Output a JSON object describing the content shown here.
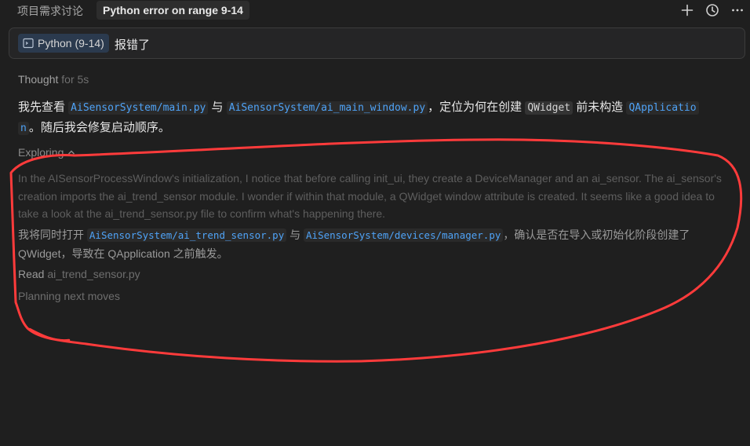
{
  "header": {
    "inactive_tab": "项目需求讨论",
    "active_tab": "Python error on range 9-14",
    "icons": [
      "plus-icon",
      "history-icon",
      "more-icon"
    ]
  },
  "input": {
    "chip_label": "Python (9-14)",
    "text": "报错了"
  },
  "thought": {
    "label": "Thought",
    "duration": "for 5s"
  },
  "response": {
    "t1": "我先查看 ",
    "c1": "AiSensorSystem/main.py",
    "t2": " 与 ",
    "c2": "AiSensorSystem/ai_main_window.py",
    "t3": "，定位为何在创建 ",
    "c3": "QWidget",
    "t4": " 前未构造 ",
    "c4a": "QApplicatio",
    "c4b": "n",
    "t5": "。随后我会修复启动顺序。"
  },
  "exploring": {
    "label": "Exploring"
  },
  "reasoning": {
    "text": "In the AISensorProcessWindow's initialization, I notice that before calling init_ui, they create a DeviceManager and an ai_sensor. The ai_sensor's creation imports the ai_trend_sensor module. I wonder if within that module, a QWidget window attribute is created. It seems like a good idea to take a look at the ai_trend_sensor.py file to confirm what's happening there."
  },
  "plan": {
    "t1": "我将同时打开 ",
    "c1": "AiSensorSystem/ai_trend_sensor.py",
    "t2": " 与 ",
    "c2": "AiSensorSystem/devices/manager.py",
    "t3": "，确认是否在导入或初始化阶段创建了 QWidget，导致在 QApplication 之前触发。"
  },
  "read": {
    "label": "Read",
    "file": "ai_trend_sensor.py"
  },
  "status": {
    "text": "Planning next moves"
  },
  "colors": {
    "background": "#1f1f1f",
    "code_blue": "#4fa3f7",
    "annotation_red": "#ff3b3b"
  }
}
